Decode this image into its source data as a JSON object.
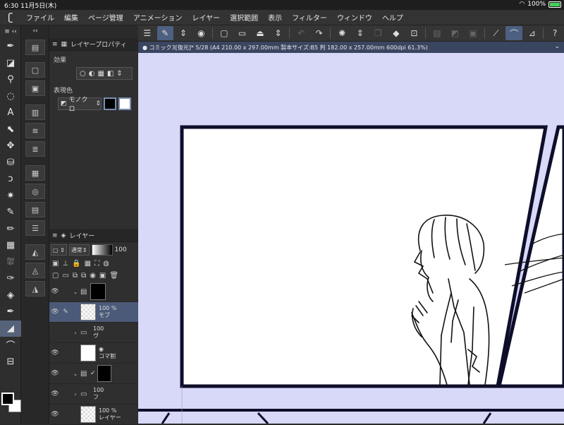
{
  "status": {
    "time": "6:30",
    "date": "11月5日(木)",
    "battery": "100%"
  },
  "menu": {
    "items": [
      "ファイル",
      "編集",
      "ページ管理",
      "アニメーション",
      "レイヤー",
      "選択範囲",
      "表示",
      "フィルター",
      "ウィンドウ",
      "ヘルプ"
    ]
  },
  "canvas": {
    "tab_title": "● コミック3[復元]* 5/28 (A4 210.00 x 297.00mm 製本サイズ:B5 判 182.00 x 257.00mm 600dpi 61.3%)",
    "background_color": "#d8d8f8"
  },
  "property_panel": {
    "title": "レイヤープロパティ",
    "effect_label": "効果",
    "expression_label": "表現色",
    "expression_value": "モノクロ"
  },
  "layer_panel": {
    "title": "レイヤー",
    "blend_mode": "通常",
    "opacity": "100",
    "layers": [
      {
        "name": "",
        "opacity": ""
      },
      {
        "name": "モブ",
        "opacity": "100 %"
      },
      {
        "name": "ヴ",
        "opacity": "100"
      },
      {
        "name": "コマ割",
        "opacity": ""
      },
      {
        "name": "",
        "opacity": ""
      },
      {
        "name": "フ",
        "opacity": "100"
      },
      {
        "name": "レイヤー",
        "opacity": "100 %"
      }
    ]
  },
  "colors": {
    "accent": "#4b5a78",
    "main_color": "#000000",
    "sub_color": "#ffffff"
  }
}
